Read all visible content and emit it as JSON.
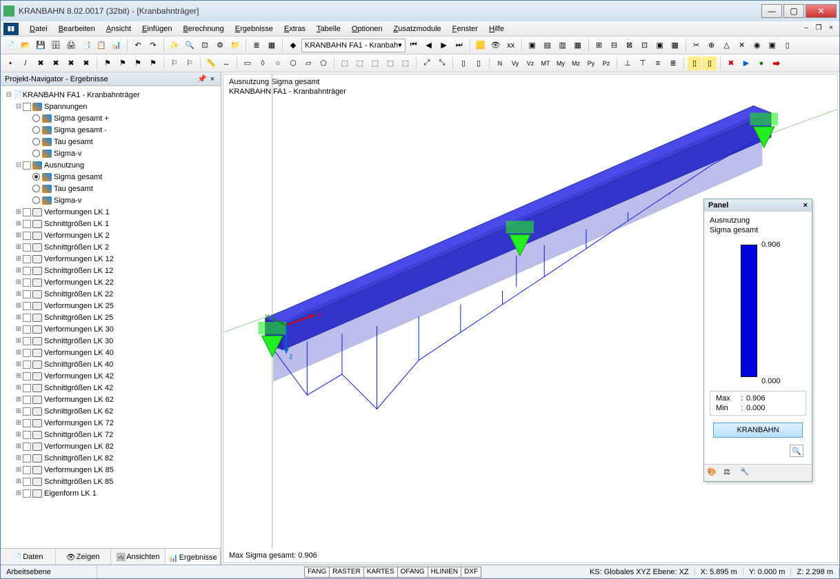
{
  "window": {
    "title": "KRANBAHN 8.02.0017 (32bit) - [Kranbahnträger]"
  },
  "menu": {
    "items": [
      "Datei",
      "Bearbeiten",
      "Ansicht",
      "Einfügen",
      "Berechnung",
      "Ergebnisse",
      "Extras",
      "Tabelle",
      "Optionen",
      "Zusatzmodule",
      "Fenster",
      "Hilfe"
    ]
  },
  "toolbar1": {
    "combo": "KRANBAHN FA1 - Kranbah"
  },
  "navigator": {
    "title": "Projekt-Navigator - Ergebnisse",
    "root": "KRANBAHN FA1 - Kranbahnträger",
    "groups": [
      {
        "label": "Spannungen",
        "icon": "diamond",
        "expanded": true,
        "children": [
          {
            "label": "Sigma gesamt +",
            "radio": false,
            "icon": "diamond"
          },
          {
            "label": "Sigma gesamt -",
            "radio": false,
            "icon": "diamond"
          },
          {
            "label": "Tau gesamt",
            "radio": false,
            "icon": "diamond"
          },
          {
            "label": "Sigma-v",
            "radio": false,
            "icon": "diamond"
          }
        ]
      },
      {
        "label": "Ausnutzung",
        "icon": "diamond",
        "expanded": true,
        "children": [
          {
            "label": "Sigma gesamt",
            "radio": true,
            "icon": "diamond"
          },
          {
            "label": "Tau gesamt",
            "radio": false,
            "icon": "diamond"
          },
          {
            "label": "Sigma-v",
            "radio": false,
            "icon": "diamond"
          }
        ]
      },
      {
        "label": "Verformungen LK 1",
        "icon": "bracket",
        "expandable": true
      },
      {
        "label": "Schnittgrößen LK 1",
        "icon": "bracket",
        "expandable": true
      },
      {
        "label": "Verformungen LK 2",
        "icon": "bracket",
        "expandable": true
      },
      {
        "label": "Schnittgrößen LK 2",
        "icon": "bracket",
        "expandable": true
      },
      {
        "label": "Verformungen LK 12",
        "icon": "bracket",
        "expandable": true
      },
      {
        "label": "Schnittgrößen LK 12",
        "icon": "bracket",
        "expandable": true
      },
      {
        "label": "Verformungen LK 22",
        "icon": "bracket",
        "expandable": true
      },
      {
        "label": "Schnittgrößen LK 22",
        "icon": "bracket",
        "expandable": true
      },
      {
        "label": "Verformungen LK 25",
        "icon": "bracket",
        "expandable": true
      },
      {
        "label": "Schnittgrößen LK 25",
        "icon": "bracket",
        "expandable": true
      },
      {
        "label": "Verformungen LK 30",
        "icon": "bracket",
        "expandable": true
      },
      {
        "label": "Schnittgrößen LK 30",
        "icon": "bracket",
        "expandable": true
      },
      {
        "label": "Verformungen LK 40",
        "icon": "bracket",
        "expandable": true
      },
      {
        "label": "Schnittgrößen LK 40",
        "icon": "bracket",
        "expandable": true
      },
      {
        "label": "Verformungen LK 42",
        "icon": "bracket",
        "expandable": true
      },
      {
        "label": "Schnittgrößen LK 42",
        "icon": "bracket",
        "expandable": true
      },
      {
        "label": "Verformungen LK 62",
        "icon": "bracket",
        "expandable": true
      },
      {
        "label": "Schnittgrößen LK 62",
        "icon": "bracket",
        "expandable": true
      },
      {
        "label": "Verformungen LK 72",
        "icon": "bracket",
        "expandable": true
      },
      {
        "label": "Schnittgrößen LK 72",
        "icon": "bracket",
        "expandable": true
      },
      {
        "label": "Verformungen LK 82",
        "icon": "bracket",
        "expandable": true
      },
      {
        "label": "Schnittgrößen LK 82",
        "icon": "bracket",
        "expandable": true
      },
      {
        "label": "Verformungen LK 85",
        "icon": "bracket",
        "expandable": true
      },
      {
        "label": "Schnittgrößen LK 85",
        "icon": "bracket",
        "expandable": true
      },
      {
        "label": "Eigenform LK 1",
        "icon": "bracket",
        "expandable": true
      }
    ],
    "tabs": [
      "Daten",
      "Zeigen",
      "Ansichten",
      "Ergebnisse"
    ],
    "active_tab": 3
  },
  "viewport": {
    "line1": "Ausnutzung Sigma gesamt",
    "line2": "KRANBAHN FA1 - Kranbahnträger",
    "bottom": "Max Sigma gesamt: 0.906"
  },
  "panel": {
    "title": "Panel",
    "sub1": "Ausnutzung",
    "sub2": "Sigma gesamt",
    "scale_max": "0.906",
    "scale_min": "0.000",
    "stat_max_label": "Max",
    "stat_max_value": "0.906",
    "stat_min_label": "Min",
    "stat_min_value": "0.000",
    "button": "KRANBAHN"
  },
  "statusbar": {
    "left": "Arbeitsebene",
    "buttons": [
      "FANG",
      "RASTER",
      "KARTES",
      "OFANG",
      "HLINIEN",
      "DXF"
    ],
    "ks": "KS: Globales XYZ Ebene: XZ",
    "x": "X: 5.895 m",
    "y": "Y: 0.000 m",
    "z": "Z: 2.298 m"
  }
}
